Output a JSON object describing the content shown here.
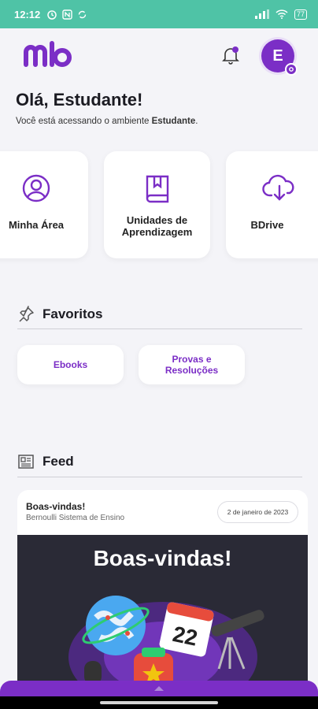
{
  "status_bar": {
    "time": "12:12",
    "battery": "77"
  },
  "header": {
    "avatar_letter": "E"
  },
  "greeting": {
    "title": "Olá, Estudante!",
    "subtitle_prefix": "Você está acessando o ambiente ",
    "subtitle_env": "Estudante",
    "subtitle_suffix": "."
  },
  "shortcuts": [
    {
      "label": "Minha Área",
      "icon": "user-circle-icon"
    },
    {
      "label": "Unidades de Aprendizagem",
      "icon": "book-bookmark-icon"
    },
    {
      "label": "BDrive",
      "icon": "cloud-download-icon"
    }
  ],
  "favorites": {
    "title": "Favoritos",
    "items": [
      {
        "label": "Ebooks"
      },
      {
        "label": "Provas e Resoluções"
      }
    ]
  },
  "feed": {
    "title": "Feed",
    "post": {
      "title": "Boas-vindas!",
      "source": "Bernoulli Sistema de Ensino",
      "date": "2 de janeiro de 2023",
      "image_title": "Boas-vindas!",
      "calendar_day": "22"
    }
  },
  "colors": {
    "accent": "#7b2ec6",
    "status_bar": "#4fc3a6",
    "background": "#f4f4f8"
  }
}
